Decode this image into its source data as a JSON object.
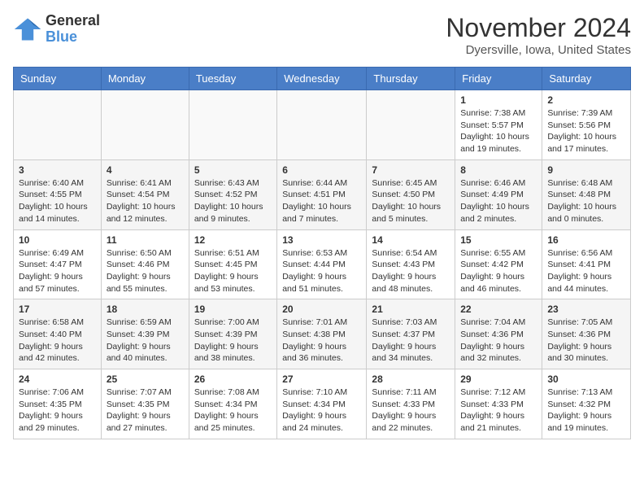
{
  "header": {
    "logo_line1": "General",
    "logo_line2": "Blue",
    "month_title": "November 2024",
    "location": "Dyersville, Iowa, United States"
  },
  "weekdays": [
    "Sunday",
    "Monday",
    "Tuesday",
    "Wednesday",
    "Thursday",
    "Friday",
    "Saturday"
  ],
  "weeks": [
    [
      {
        "day": "",
        "info": ""
      },
      {
        "day": "",
        "info": ""
      },
      {
        "day": "",
        "info": ""
      },
      {
        "day": "",
        "info": ""
      },
      {
        "day": "",
        "info": ""
      },
      {
        "day": "1",
        "info": "Sunrise: 7:38 AM\nSunset: 5:57 PM\nDaylight: 10 hours and 19 minutes."
      },
      {
        "day": "2",
        "info": "Sunrise: 7:39 AM\nSunset: 5:56 PM\nDaylight: 10 hours and 17 minutes."
      }
    ],
    [
      {
        "day": "3",
        "info": "Sunrise: 6:40 AM\nSunset: 4:55 PM\nDaylight: 10 hours and 14 minutes."
      },
      {
        "day": "4",
        "info": "Sunrise: 6:41 AM\nSunset: 4:54 PM\nDaylight: 10 hours and 12 minutes."
      },
      {
        "day": "5",
        "info": "Sunrise: 6:43 AM\nSunset: 4:52 PM\nDaylight: 10 hours and 9 minutes."
      },
      {
        "day": "6",
        "info": "Sunrise: 6:44 AM\nSunset: 4:51 PM\nDaylight: 10 hours and 7 minutes."
      },
      {
        "day": "7",
        "info": "Sunrise: 6:45 AM\nSunset: 4:50 PM\nDaylight: 10 hours and 5 minutes."
      },
      {
        "day": "8",
        "info": "Sunrise: 6:46 AM\nSunset: 4:49 PM\nDaylight: 10 hours and 2 minutes."
      },
      {
        "day": "9",
        "info": "Sunrise: 6:48 AM\nSunset: 4:48 PM\nDaylight: 10 hours and 0 minutes."
      }
    ],
    [
      {
        "day": "10",
        "info": "Sunrise: 6:49 AM\nSunset: 4:47 PM\nDaylight: 9 hours and 57 minutes."
      },
      {
        "day": "11",
        "info": "Sunrise: 6:50 AM\nSunset: 4:46 PM\nDaylight: 9 hours and 55 minutes."
      },
      {
        "day": "12",
        "info": "Sunrise: 6:51 AM\nSunset: 4:45 PM\nDaylight: 9 hours and 53 minutes."
      },
      {
        "day": "13",
        "info": "Sunrise: 6:53 AM\nSunset: 4:44 PM\nDaylight: 9 hours and 51 minutes."
      },
      {
        "day": "14",
        "info": "Sunrise: 6:54 AM\nSunset: 4:43 PM\nDaylight: 9 hours and 48 minutes."
      },
      {
        "day": "15",
        "info": "Sunrise: 6:55 AM\nSunset: 4:42 PM\nDaylight: 9 hours and 46 minutes."
      },
      {
        "day": "16",
        "info": "Sunrise: 6:56 AM\nSunset: 4:41 PM\nDaylight: 9 hours and 44 minutes."
      }
    ],
    [
      {
        "day": "17",
        "info": "Sunrise: 6:58 AM\nSunset: 4:40 PM\nDaylight: 9 hours and 42 minutes."
      },
      {
        "day": "18",
        "info": "Sunrise: 6:59 AM\nSunset: 4:39 PM\nDaylight: 9 hours and 40 minutes."
      },
      {
        "day": "19",
        "info": "Sunrise: 7:00 AM\nSunset: 4:39 PM\nDaylight: 9 hours and 38 minutes."
      },
      {
        "day": "20",
        "info": "Sunrise: 7:01 AM\nSunset: 4:38 PM\nDaylight: 9 hours and 36 minutes."
      },
      {
        "day": "21",
        "info": "Sunrise: 7:03 AM\nSunset: 4:37 PM\nDaylight: 9 hours and 34 minutes."
      },
      {
        "day": "22",
        "info": "Sunrise: 7:04 AM\nSunset: 4:36 PM\nDaylight: 9 hours and 32 minutes."
      },
      {
        "day": "23",
        "info": "Sunrise: 7:05 AM\nSunset: 4:36 PM\nDaylight: 9 hours and 30 minutes."
      }
    ],
    [
      {
        "day": "24",
        "info": "Sunrise: 7:06 AM\nSunset: 4:35 PM\nDaylight: 9 hours and 29 minutes."
      },
      {
        "day": "25",
        "info": "Sunrise: 7:07 AM\nSunset: 4:35 PM\nDaylight: 9 hours and 27 minutes."
      },
      {
        "day": "26",
        "info": "Sunrise: 7:08 AM\nSunset: 4:34 PM\nDaylight: 9 hours and 25 minutes."
      },
      {
        "day": "27",
        "info": "Sunrise: 7:10 AM\nSunset: 4:34 PM\nDaylight: 9 hours and 24 minutes."
      },
      {
        "day": "28",
        "info": "Sunrise: 7:11 AM\nSunset: 4:33 PM\nDaylight: 9 hours and 22 minutes."
      },
      {
        "day": "29",
        "info": "Sunrise: 7:12 AM\nSunset: 4:33 PM\nDaylight: 9 hours and 21 minutes."
      },
      {
        "day": "30",
        "info": "Sunrise: 7:13 AM\nSunset: 4:32 PM\nDaylight: 9 hours and 19 minutes."
      }
    ]
  ]
}
